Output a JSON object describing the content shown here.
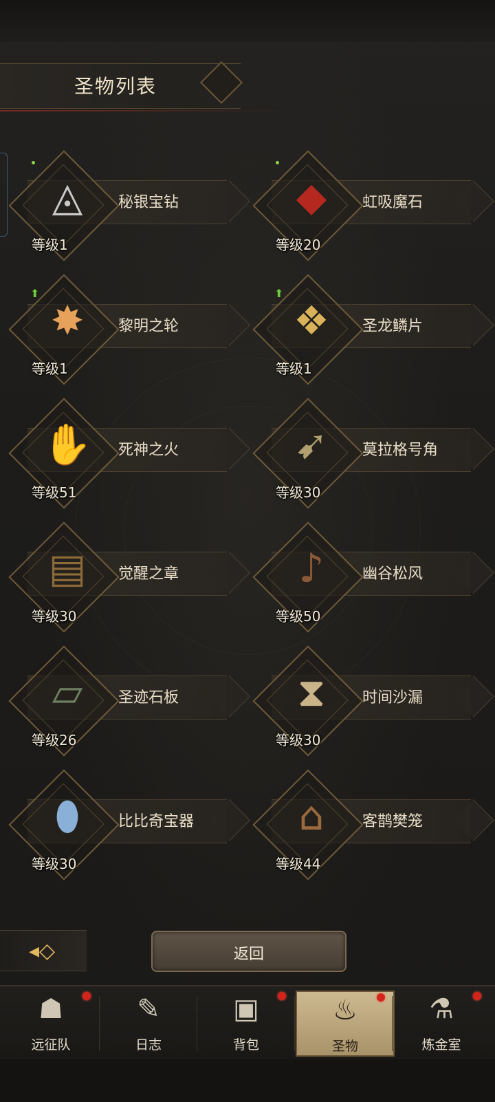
{
  "header": {
    "title": "圣物列表"
  },
  "relics": [
    {
      "name": "秘银宝钻",
      "level": "等级1",
      "icon": "◬",
      "color": "#c9c9c9",
      "new_dot": true,
      "upgrade": false
    },
    {
      "name": "虹吸魔石",
      "level": "等级20",
      "icon": "◆",
      "color": "#b5281f",
      "new_dot": true,
      "upgrade": false
    },
    {
      "name": "黎明之轮",
      "level": "等级1",
      "icon": "✸",
      "color": "#e6a25a",
      "new_dot": false,
      "upgrade": true
    },
    {
      "name": "圣龙鳞片",
      "level": "等级1",
      "icon": "❖",
      "color": "#d9b25a",
      "new_dot": false,
      "upgrade": true
    },
    {
      "name": "死神之火",
      "level": "等级51",
      "icon": "✋",
      "color": "#7fa7e0",
      "new_dot": false,
      "upgrade": false
    },
    {
      "name": "莫拉格号角",
      "level": "等级30",
      "icon": "➹",
      "color": "#b0a070",
      "new_dot": false,
      "upgrade": false
    },
    {
      "name": "觉醒之章",
      "level": "等级30",
      "icon": "▤",
      "color": "#8c6a3a",
      "new_dot": false,
      "upgrade": false
    },
    {
      "name": "幽谷松风",
      "level": "等级50",
      "icon": "♪",
      "color": "#8a5a38",
      "new_dot": false,
      "upgrade": false
    },
    {
      "name": "圣迹石板",
      "level": "等级26",
      "icon": "▱",
      "color": "#6e8060",
      "new_dot": false,
      "upgrade": false
    },
    {
      "name": "时间沙漏",
      "level": "等级30",
      "icon": "⧗",
      "color": "#c9b48a",
      "new_dot": false,
      "upgrade": false
    },
    {
      "name": "比比奇宝器",
      "level": "等级30",
      "icon": "⬮",
      "color": "#8ab0d8",
      "new_dot": false,
      "upgrade": false
    },
    {
      "name": "客鹊樊笼",
      "level": "等级44",
      "icon": "⌂",
      "color": "#9a6a3e",
      "new_dot": false,
      "upgrade": false
    }
  ],
  "footer": {
    "back_label": "返回",
    "arrow_icon": "arrow-left-icon"
  },
  "tabs": [
    {
      "label": "远征队",
      "icon": "☗",
      "badge": true,
      "active": false
    },
    {
      "label": "日志",
      "icon": "✎",
      "badge": false,
      "active": false
    },
    {
      "label": "背包",
      "icon": "▣",
      "badge": true,
      "active": false
    },
    {
      "label": "圣物",
      "icon": "♨",
      "badge": true,
      "active": true
    },
    {
      "label": "炼金室",
      "icon": "⚗",
      "badge": true,
      "active": false
    }
  ],
  "colors": {
    "accent": "#6e5a3a",
    "badge": "#d3241c",
    "upgrade": "#6fcf3a"
  }
}
